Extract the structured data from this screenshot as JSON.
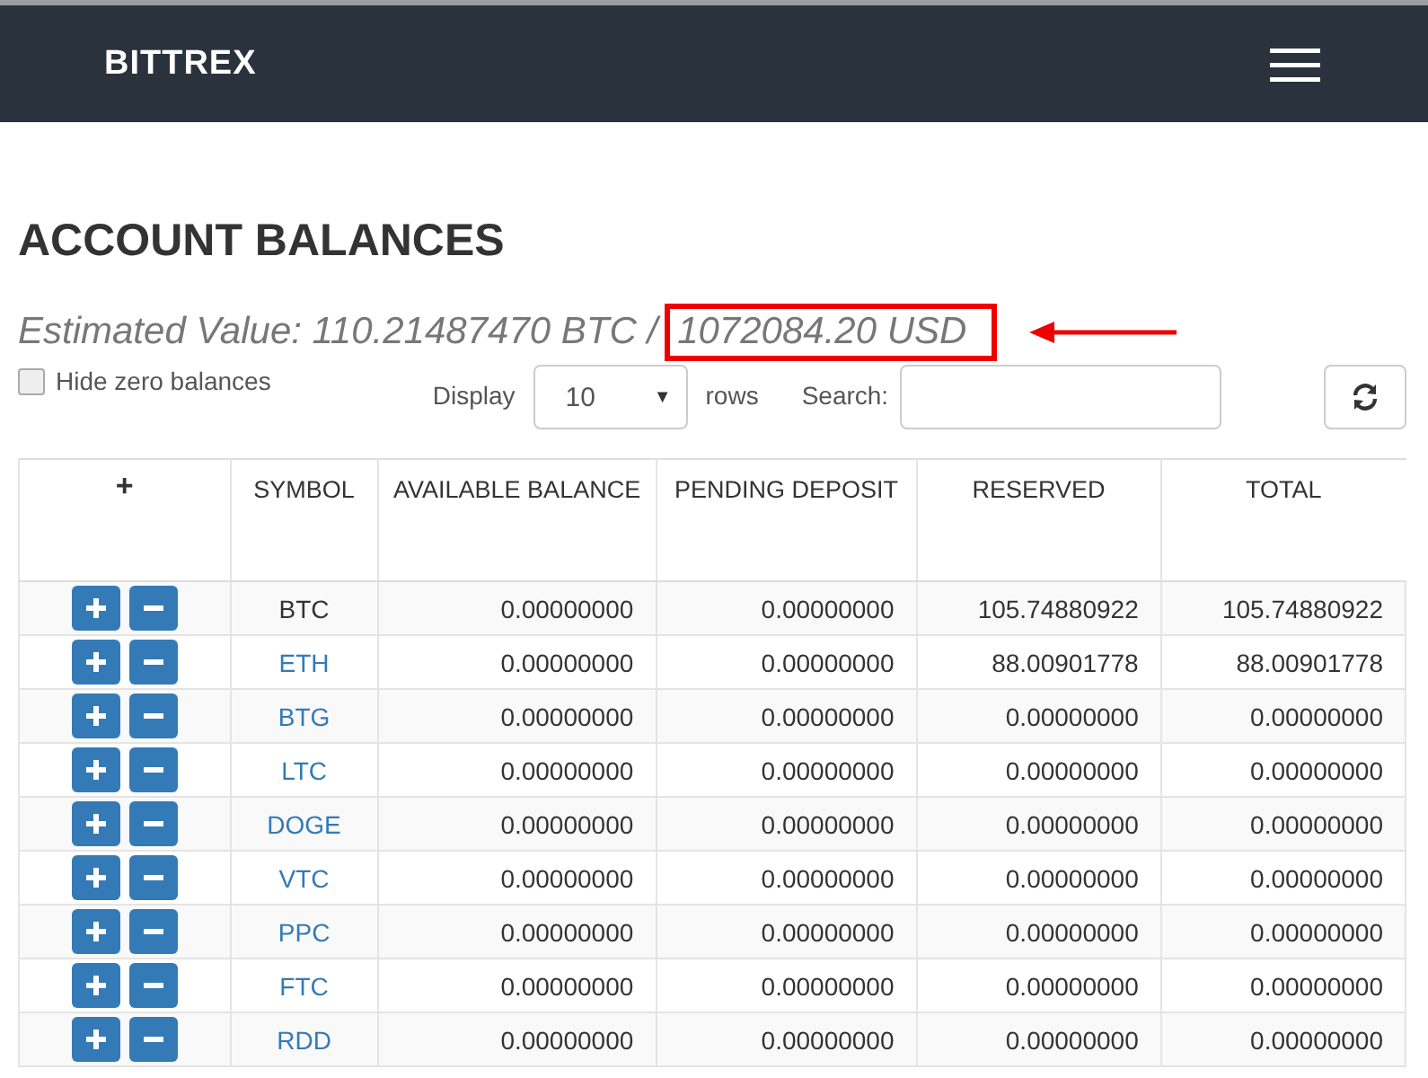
{
  "navbar": {
    "logo": "BITTREX"
  },
  "title": "ACCOUNT BALANCES",
  "estimate": {
    "prefix": "Estimated Value: 110.21487470 BTC /",
    "highlight": "1072084.20 USD"
  },
  "controls": {
    "hide_zero": {
      "label": "Hide zero balances",
      "checked": false
    },
    "display_label": "Display",
    "display_value": "10",
    "display_caret": "▼",
    "rows_label": "rows",
    "search_label": "Search:"
  },
  "table": {
    "columns": [
      "+",
      "SYMBOL",
      "AVAILABLE BALANCE",
      "PENDING DEPOSIT",
      "RESERVED",
      "TOTAL"
    ],
    "rows": [
      {
        "symbol": "BTC",
        "link": false,
        "available": "0.00000000",
        "pending": "0.00000000",
        "reserved": "105.74880922",
        "total": "105.74880922"
      },
      {
        "symbol": "ETH",
        "link": true,
        "available": "0.00000000",
        "pending": "0.00000000",
        "reserved": "88.00901778",
        "total": "88.00901778"
      },
      {
        "symbol": "BTG",
        "link": true,
        "available": "0.00000000",
        "pending": "0.00000000",
        "reserved": "0.00000000",
        "total": "0.00000000"
      },
      {
        "symbol": "LTC",
        "link": true,
        "available": "0.00000000",
        "pending": "0.00000000",
        "reserved": "0.00000000",
        "total": "0.00000000"
      },
      {
        "symbol": "DOGE",
        "link": true,
        "available": "0.00000000",
        "pending": "0.00000000",
        "reserved": "0.00000000",
        "total": "0.00000000"
      },
      {
        "symbol": "VTC",
        "link": true,
        "available": "0.00000000",
        "pending": "0.00000000",
        "reserved": "0.00000000",
        "total": "0.00000000"
      },
      {
        "symbol": "PPC",
        "link": true,
        "available": "0.00000000",
        "pending": "0.00000000",
        "reserved": "0.00000000",
        "total": "0.00000000"
      },
      {
        "symbol": "FTC",
        "link": true,
        "available": "0.00000000",
        "pending": "0.00000000",
        "reserved": "0.00000000",
        "total": "0.00000000"
      },
      {
        "symbol": "RDD",
        "link": true,
        "available": "0.00000000",
        "pending": "0.00000000",
        "reserved": "0.00000000",
        "total": "0.00000000"
      }
    ]
  }
}
